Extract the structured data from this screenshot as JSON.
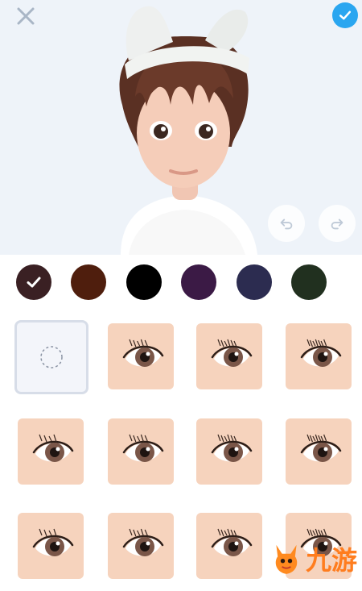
{
  "toolbar": {
    "close_icon": "close-icon",
    "confirm_icon": "check-icon"
  },
  "history": {
    "undo_icon": "undo-icon",
    "redo_icon": "redo-icon"
  },
  "colors": {
    "selected_index": 0,
    "swatches": [
      "#3a2023",
      "#4f1e0d",
      "#000000",
      "#3b1a45",
      "#2c2c50",
      "#21301f"
    ]
  },
  "eye_styles": {
    "selected": "none",
    "items": [
      "none",
      "style-1",
      "style-2",
      "style-3",
      "style-4",
      "style-5",
      "style-6",
      "style-7",
      "style-8",
      "style-9",
      "style-10",
      "style-11"
    ]
  },
  "watermark": {
    "text": "九游"
  }
}
